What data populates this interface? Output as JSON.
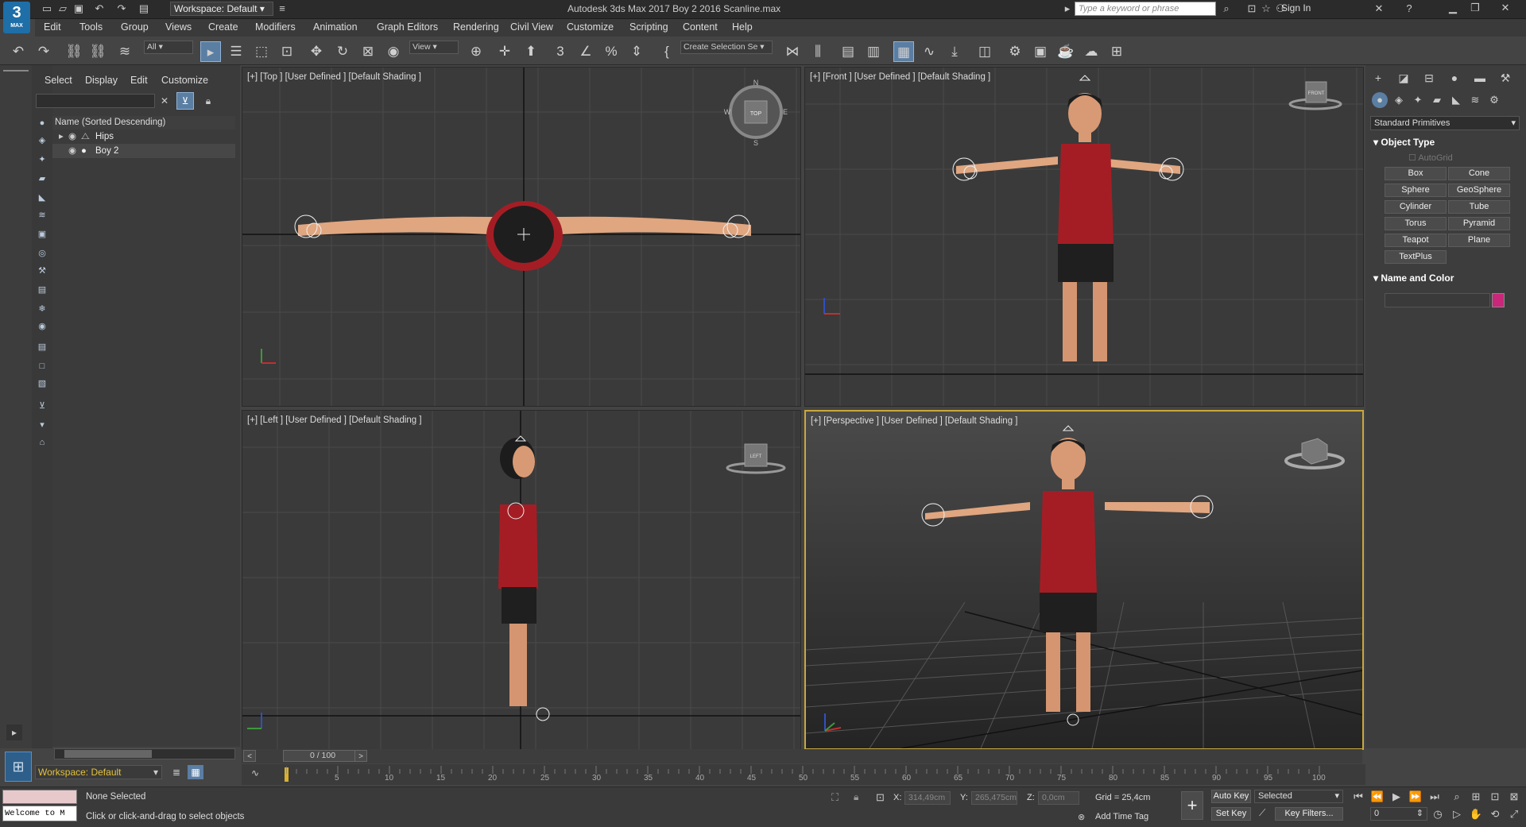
{
  "app": {
    "logo_text": "3",
    "logo_sub": "MAX",
    "workspace": "Workspace: Default",
    "title": "Autodesk 3ds Max 2017     Boy 2 2016 Scanline.max",
    "search_placeholder": "Type a keyword or phrase",
    "sign_in": "Sign In"
  },
  "menu": [
    "Edit",
    "Tools",
    "Group",
    "Views",
    "Create",
    "Modifiers",
    "Animation",
    "Graph Editors",
    "Rendering",
    "Civil View",
    "Customize",
    "Scripting",
    "Content",
    "Help"
  ],
  "toolbar": {
    "filter_all": "All",
    "ref_coord": "View",
    "selection_set": "Create Selection Se"
  },
  "explorer": {
    "tabs": [
      "Select",
      "Display",
      "Edit",
      "Customize"
    ],
    "header": "Name (Sorted Descending)",
    "rows": [
      {
        "name": "Hips"
      },
      {
        "name": "Boy 2"
      }
    ],
    "workspace": "Workspace: Default"
  },
  "viewports": {
    "top": "[+] [Top ] [User Defined ] [Default Shading ]",
    "front": "[+] [Front ] [User Defined ] [Default Shading ]",
    "left": "[+] [Left ] [User Defined ] [Default Shading ]",
    "perspective": "[+] [Perspective ] [User Defined ] [Default Shading ]",
    "cube_top": "TOP",
    "cube_front": "FRONT",
    "cube_left": "LEFT",
    "compass_n": "N",
    "compass_s": "S",
    "compass_e": "E",
    "compass_w": "W"
  },
  "command_panel": {
    "category": "Standard Primitives",
    "object_type_title": "Object Type",
    "autogrid": "AutoGrid",
    "buttons": [
      "Box",
      "Cone",
      "Sphere",
      "GeoSphere",
      "Cylinder",
      "Tube",
      "Torus",
      "Pyramid",
      "Teapot",
      "Plane",
      "TextPlus"
    ],
    "name_color_title": "Name and Color",
    "color": "#c8277a"
  },
  "timeline": {
    "slider": "0 / 100",
    "ticks": [
      "5",
      "10",
      "15",
      "20",
      "25",
      "30",
      "35",
      "40",
      "45",
      "50",
      "55",
      "60",
      "65",
      "70",
      "75",
      "80",
      "85",
      "90",
      "95",
      "100"
    ]
  },
  "status": {
    "maxscript": "Welcome to M",
    "selection": "None Selected",
    "prompt": "Click or click-and-drag to select objects",
    "x_label": "X:",
    "x_val": "314,49cm",
    "y_label": "Y:",
    "y_val": "265,475cm",
    "z_label": "Z:",
    "z_val": "0,0cm",
    "grid": "Grid = 25,4cm",
    "add_time_tag": "Add Time Tag",
    "auto_key": "Auto Key",
    "set_key": "Set Key",
    "selected": "Selected",
    "key_filters": "Key Filters...",
    "frame": "0"
  }
}
